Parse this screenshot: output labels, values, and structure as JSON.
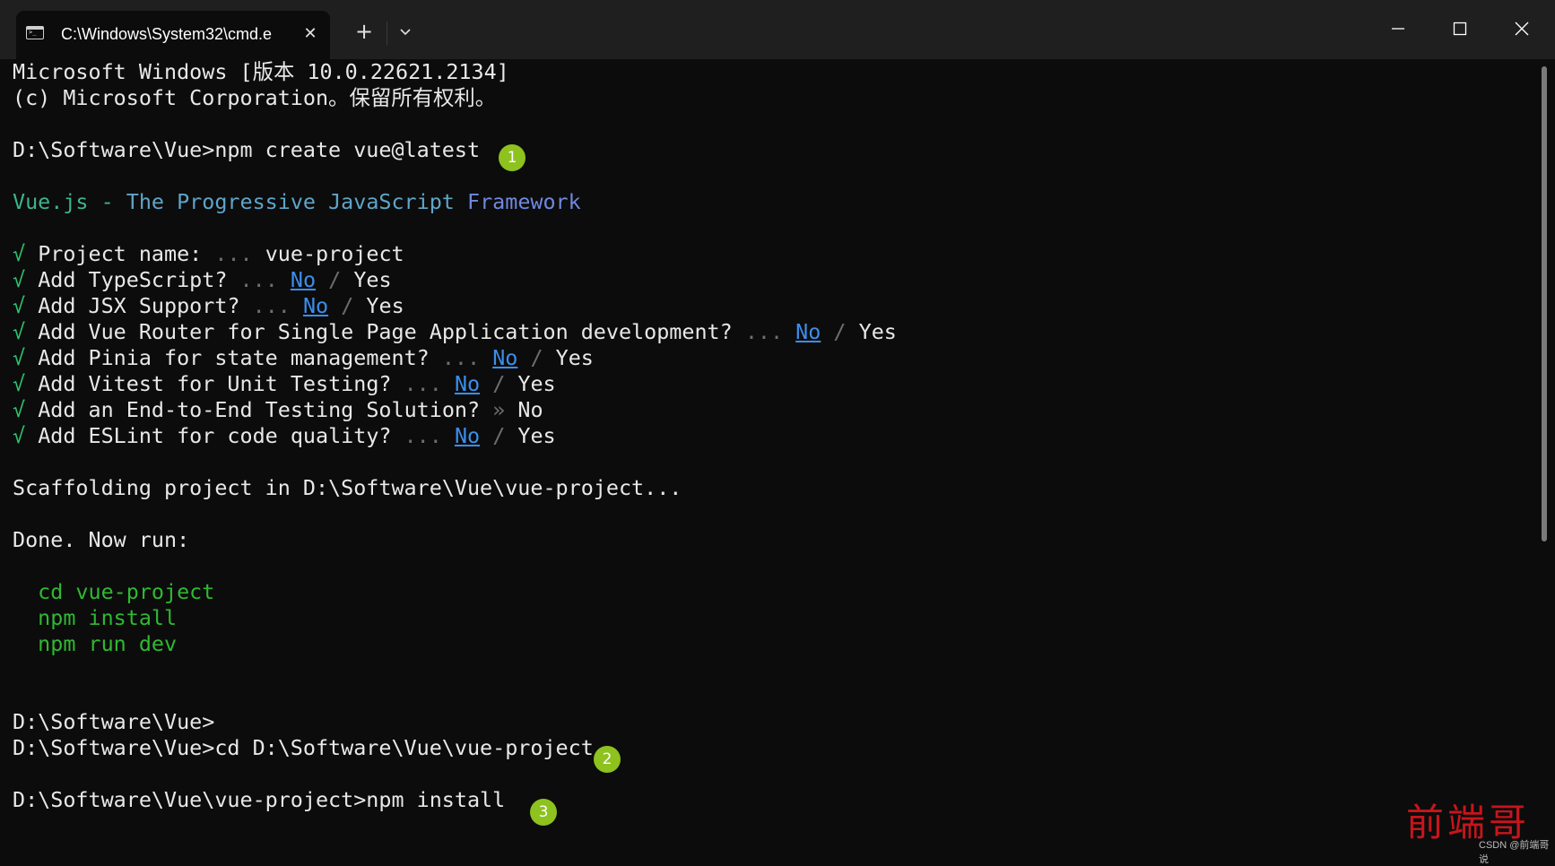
{
  "window": {
    "tab_title": "C:\\Windows\\System32\\cmd.e",
    "tab_close_icon": "✕",
    "new_tab_icon": "+",
    "icons": [
      "cmd-icon",
      "close-icon",
      "plus-icon",
      "chevron-down-icon",
      "minimize-icon",
      "maximize-icon",
      "close-window-icon"
    ]
  },
  "terminal": {
    "header1": "Microsoft Windows [版本 10.0.22621.2134]",
    "header2": "(c) Microsoft Corporation。保留所有权利。",
    "cmd1": "D:\\Software\\Vue>npm create vue@latest",
    "banner_a": "Vue.js - ",
    "banner_b": "The Progressive JavaScript ",
    "banner_c": "Framework",
    "check": "√",
    "dots": "...",
    "raquo": "»",
    "slash": "/",
    "no": "No",
    "yes": "Yes",
    "q_project": "Project name:",
    "project_value": "vue-project",
    "q_ts": "Add TypeScript?",
    "q_jsx": "Add JSX Support?",
    "q_router": "Add Vue Router for Single Page Application development?",
    "q_pinia": "Add Pinia for state management?",
    "q_vitest": "Add Vitest for Unit Testing?",
    "q_e2e": "Add an End-to-End Testing Solution?",
    "q_eslint": "Add ESLint for code quality?",
    "scaffold": "Scaffolding project in D:\\Software\\Vue\\vue-project...",
    "done": "Done. Now run:",
    "run1": "  cd vue-project",
    "run2": "  npm install",
    "run3": "  npm run dev",
    "prompt1": "D:\\Software\\Vue>",
    "cmd2": "D:\\Software\\Vue>cd D:\\Software\\Vue\\vue-project",
    "cmd3": "D:\\Software\\Vue\\vue-project>npm install"
  },
  "badges": {
    "b1": "1",
    "b2": "2",
    "b3": "3"
  },
  "watermark": "前端哥",
  "credit": "CSDN @前端哥说"
}
